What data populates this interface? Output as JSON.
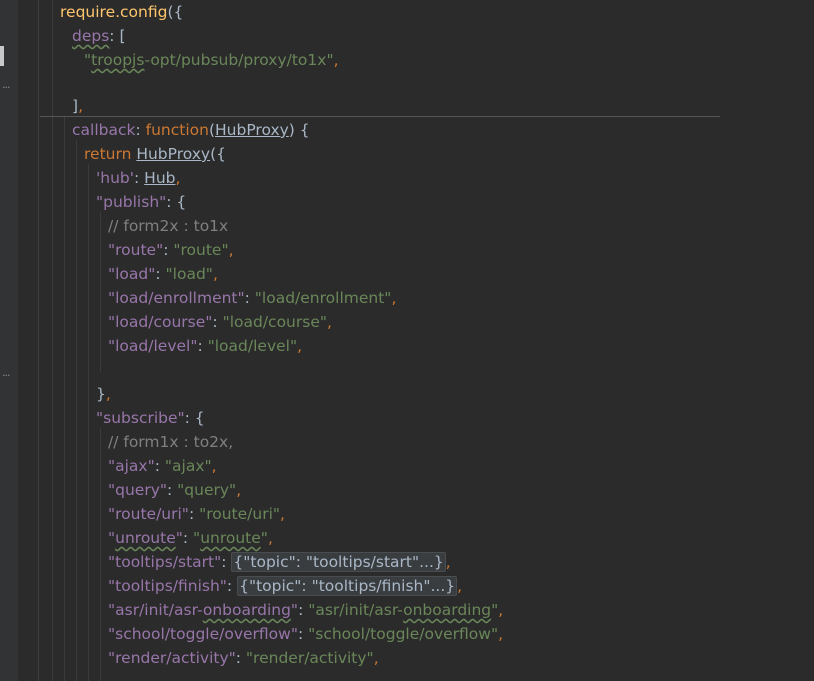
{
  "editor": {
    "lines": [
      {
        "tokens": [
          {
            "t": "require.config",
            "c": "fn"
          },
          {
            "t": "({",
            "c": "p"
          }
        ]
      },
      {
        "tokens": [
          {
            "t": "deps",
            "c": "prop typo"
          },
          {
            "t": ": [",
            "c": "p"
          }
        ]
      },
      {
        "tokens": [
          {
            "t": "\"",
            "c": "str"
          },
          {
            "t": "troopjs",
            "c": "str typo"
          },
          {
            "t": "-opt/pubsub/proxy/to1x\"",
            "c": "str"
          },
          {
            "t": ",",
            "c": "kw"
          }
        ]
      },
      {
        "tokens": []
      },
      {
        "tokens": [
          {
            "t": "]",
            "c": "p"
          },
          {
            "t": ",",
            "c": "kw"
          }
        ]
      },
      {
        "tokens": [
          {
            "t": "callback",
            "c": "prop"
          },
          {
            "t": ": ",
            "c": "p"
          },
          {
            "t": "function",
            "c": "kw"
          },
          {
            "t": "(",
            "c": "p"
          },
          {
            "t": "HubProxy",
            "c": "param"
          },
          {
            "t": ") {",
            "c": "p"
          }
        ]
      },
      {
        "tokens": [
          {
            "t": "return ",
            "c": "kw"
          },
          {
            "t": "HubProxy",
            "c": "param"
          },
          {
            "t": "({",
            "c": "p"
          }
        ]
      },
      {
        "tokens": [
          {
            "t": "'hub'",
            "c": "prop"
          },
          {
            "t": ": ",
            "c": "p"
          },
          {
            "t": "Hub",
            "c": "param"
          },
          {
            "t": ",",
            "c": "kw"
          }
        ]
      },
      {
        "tokens": [
          {
            "t": "\"publish\"",
            "c": "prop"
          },
          {
            "t": ": {",
            "c": "p"
          }
        ]
      },
      {
        "tokens": [
          {
            "t": "// form2x : to1x",
            "c": "cmt"
          }
        ]
      },
      {
        "tokens": [
          {
            "t": "\"route\"",
            "c": "prop"
          },
          {
            "t": ": ",
            "c": "p"
          },
          {
            "t": "\"route\"",
            "c": "str"
          },
          {
            "t": ",",
            "c": "kw"
          }
        ]
      },
      {
        "tokens": [
          {
            "t": "\"load\"",
            "c": "prop"
          },
          {
            "t": ": ",
            "c": "p"
          },
          {
            "t": "\"load\"",
            "c": "str"
          },
          {
            "t": ",",
            "c": "kw"
          }
        ]
      },
      {
        "tokens": [
          {
            "t": "\"load/enrollment\"",
            "c": "prop"
          },
          {
            "t": ": ",
            "c": "p"
          },
          {
            "t": "\"load/enrollment\"",
            "c": "str"
          },
          {
            "t": ",",
            "c": "kw"
          }
        ]
      },
      {
        "tokens": [
          {
            "t": "\"load/course\"",
            "c": "prop"
          },
          {
            "t": ": ",
            "c": "p"
          },
          {
            "t": "\"load/course\"",
            "c": "str"
          },
          {
            "t": ",",
            "c": "kw"
          }
        ]
      },
      {
        "tokens": [
          {
            "t": "\"load/level\"",
            "c": "prop"
          },
          {
            "t": ": ",
            "c": "p"
          },
          {
            "t": "\"load/level\"",
            "c": "str"
          },
          {
            "t": ",",
            "c": "kw"
          }
        ]
      },
      {
        "tokens": []
      },
      {
        "tokens": [
          {
            "t": "}",
            "c": "p"
          },
          {
            "t": ",",
            "c": "kw"
          }
        ]
      },
      {
        "tokens": [
          {
            "t": "\"subscribe\"",
            "c": "prop"
          },
          {
            "t": ": {",
            "c": "p"
          }
        ]
      },
      {
        "tokens": [
          {
            "t": "// form1x : to2x,",
            "c": "cmt"
          }
        ]
      },
      {
        "tokens": [
          {
            "t": "\"ajax\"",
            "c": "prop"
          },
          {
            "t": ": ",
            "c": "p"
          },
          {
            "t": "\"ajax\"",
            "c": "str"
          },
          {
            "t": ",",
            "c": "kw"
          }
        ]
      },
      {
        "tokens": [
          {
            "t": "\"query\"",
            "c": "prop"
          },
          {
            "t": ": ",
            "c": "p"
          },
          {
            "t": "\"query\"",
            "c": "str"
          },
          {
            "t": ",",
            "c": "kw"
          }
        ]
      },
      {
        "tokens": [
          {
            "t": "\"route/uri\"",
            "c": "prop"
          },
          {
            "t": ": ",
            "c": "p"
          },
          {
            "t": "\"route/uri\"",
            "c": "str"
          },
          {
            "t": ",",
            "c": "kw"
          }
        ]
      },
      {
        "tokens": [
          {
            "t": "\"",
            "c": "prop"
          },
          {
            "t": "unroute",
            "c": "prop typo"
          },
          {
            "t": "\"",
            "c": "prop"
          },
          {
            "t": ": ",
            "c": "p"
          },
          {
            "t": "\"",
            "c": "str"
          },
          {
            "t": "unroute",
            "c": "str typo"
          },
          {
            "t": "\"",
            "c": "str"
          },
          {
            "t": ",",
            "c": "kw"
          }
        ]
      },
      {
        "tokens": [
          {
            "t": "\"tooltips/start\"",
            "c": "prop"
          },
          {
            "t": ": ",
            "c": "p"
          },
          {
            "t": "{\"topic\": \"tooltips/start\"...}",
            "c": "fold"
          },
          {
            "t": ",",
            "c": "kw"
          }
        ]
      },
      {
        "tokens": [
          {
            "t": "\"tooltips/finish\"",
            "c": "prop"
          },
          {
            "t": ": ",
            "c": "p"
          },
          {
            "t": "{\"topic\": \"tooltips/finish\"...}",
            "c": "fold"
          },
          {
            "t": ",",
            "c": "kw"
          }
        ]
      },
      {
        "tokens": [
          {
            "t": "\"asr/init/asr-",
            "c": "prop"
          },
          {
            "t": "onboarding",
            "c": "prop typo"
          },
          {
            "t": "\"",
            "c": "prop"
          },
          {
            "t": ": ",
            "c": "p"
          },
          {
            "t": "\"asr/init/asr-",
            "c": "str"
          },
          {
            "t": "onboarding",
            "c": "str typo"
          },
          {
            "t": "\"",
            "c": "str"
          },
          {
            "t": ",",
            "c": "kw"
          }
        ]
      },
      {
        "tokens": [
          {
            "t": "\"school/toggle/overflow\"",
            "c": "prop"
          },
          {
            "t": ": ",
            "c": "p"
          },
          {
            "t": "\"school/toggle/overflow\"",
            "c": "str"
          },
          {
            "t": ",",
            "c": "kw"
          }
        ]
      },
      {
        "tokens": [
          {
            "t": "\"render/activity\"",
            "c": "prop"
          },
          {
            "t": ": ",
            "c": "p"
          },
          {
            "t": "\"render/activity\"",
            "c": "str"
          },
          {
            "t": ",",
            "c": "kw"
          }
        ]
      }
    ],
    "gutter_markers": [
      "...",
      "..."
    ]
  },
  "colors": {
    "background": "#2b2b2b",
    "keyword": "#cc7832",
    "function": "#ffc66d",
    "property": "#9876aa",
    "string": "#6a8759",
    "comment": "#808080",
    "text": "#a9b7c6"
  }
}
